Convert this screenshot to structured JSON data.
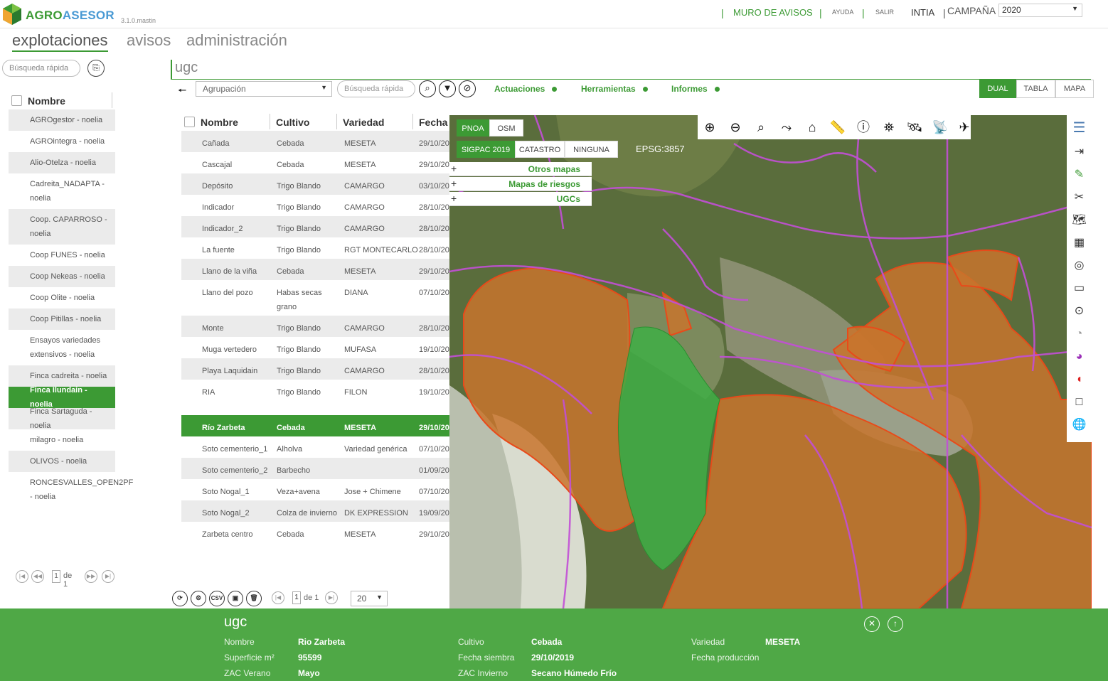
{
  "header": {
    "brand_part1": "AGRO",
    "brand_part2": "ASESOR",
    "version": "3.1.0.mastin",
    "muro": "MURO DE AVISOS",
    "ayuda": "AYUDA",
    "salir": "SALIR",
    "user": "INTIA",
    "campana_label": "CAMPAÑA",
    "campana_value": "2020"
  },
  "nav": {
    "explotaciones": "explotaciones",
    "avisos": "avisos",
    "administracion": "administración"
  },
  "sidebar": {
    "search_placeholder": "Búsqueda rápida",
    "header": "Nombre",
    "items": [
      "AGROgestor - noelia",
      "AGROintegra - noelia",
      "Alio-Otelza - noelia",
      "Cadreita_NADAPTA - noelia",
      "Coop. CAPARROSO - noelia",
      "Coop FUNES - noelia",
      "Coop Nekeas - noelia",
      "Coop Olite - noelia",
      "Coop Pitillas - noelia",
      "Ensayos variedades extensivos - noelia",
      "Finca cadreita - noelia",
      "Finca Ilundain - noelia",
      "Finca Sartaguda - noelia",
      "milagro - noelia",
      "OLIVOS - noelia",
      "RONCESVALLES_OPEN2PF - noelia"
    ],
    "page": "1",
    "page_of": "de 1"
  },
  "main": {
    "title": "ugc",
    "agrupacion": "Agrupación",
    "search_placeholder": "Búsqueda rápida",
    "menu": [
      "Actuaciones",
      "Herramientas",
      "Informes"
    ],
    "views": [
      "DUAL",
      "TABLA",
      "MAPA"
    ],
    "table": {
      "headers": [
        "Nombre",
        "Cultivo",
        "Variedad",
        "Fecha"
      ],
      "rows": [
        [
          "Cañada",
          "Cebada",
          "MESETA",
          "29/10/20"
        ],
        [
          "Cascajal",
          "Cebada",
          "MESETA",
          "29/10/20"
        ],
        [
          "Depósito",
          "Trigo Blando",
          "CAMARGO",
          "03/10/20"
        ],
        [
          "Indicador",
          "Trigo Blando",
          "CAMARGO",
          "28/10/20"
        ],
        [
          "Indicador_2",
          "Trigo Blando",
          "CAMARGO",
          "28/10/20"
        ],
        [
          "La fuente",
          "Trigo Blando",
          "RGT MONTECARLO",
          "28/10/20"
        ],
        [
          "Llano de la viña",
          "Cebada",
          "MESETA",
          "29/10/20"
        ],
        [
          "Llano del pozo",
          "Habas secas grano",
          "DIANA",
          "07/10/20"
        ],
        [
          "Monte",
          "Trigo Blando",
          "CAMARGO",
          "28/10/20"
        ],
        [
          "Muga vertedero",
          "Trigo Blando",
          "MUFASA",
          "19/10/20"
        ],
        [
          "Playa Laquidain",
          "Trigo Blando",
          "CAMARGO",
          "28/10/20"
        ],
        [
          "RIA",
          "Trigo Blando",
          "FILON",
          "19/10/20"
        ],
        [
          "Río Zarbeta",
          "Cebada",
          "MESETA",
          "29/10/20"
        ],
        [
          "Soto cementerio_1",
          "Alholva",
          "Variedad genérica",
          "07/10/20"
        ],
        [
          "Soto cementerio_2",
          "Barbecho",
          "",
          "01/09/20"
        ],
        [
          "Soto Nogal_1",
          "Veza+avena",
          "Jose + Chimene",
          "07/10/20"
        ],
        [
          "Soto Nogal_2",
          "Colza de invierno",
          "DK EXPRESSION",
          "19/09/20"
        ],
        [
          "Zarbeta centro",
          "Cebada",
          "MESETA",
          "29/10/20"
        ]
      ]
    },
    "page": "1",
    "page_of": "de 1",
    "page_size": "20",
    "csv": "CSV"
  },
  "map": {
    "base_layers": [
      "PNOA",
      "OSM"
    ],
    "sigpac_layers": [
      "SIGPAC 2019",
      "CATASTRO",
      "NINGUNA"
    ],
    "epsg": "EPSG:3857",
    "accordions": [
      "Otros mapas",
      "Mapas de riesgos",
      "UGCs"
    ],
    "colors": {
      "parcel": "#c8742d",
      "selected": "#3fae45",
      "sigpac": "#c24fd6"
    }
  },
  "info": {
    "title": "ugc",
    "fields": {
      "nombre_l": "Nombre",
      "nombre_v": "Rio Zarbeta",
      "sup_l": "Superficie m²",
      "sup_v": "95599",
      "zacv_l": "ZAC Verano",
      "zacv_v": "Mayo",
      "cultivo_l": "Cultivo",
      "cultivo_v": "Cebada",
      "fsiembra_l": "Fecha siembra",
      "fsiembra_v": "29/10/2019",
      "zaci_l": "ZAC Invierno",
      "zaci_v": "Secano Húmedo Frío",
      "variedad_l": "Variedad",
      "variedad_v": "MESETA",
      "fprod_l": "Fecha producción"
    }
  }
}
